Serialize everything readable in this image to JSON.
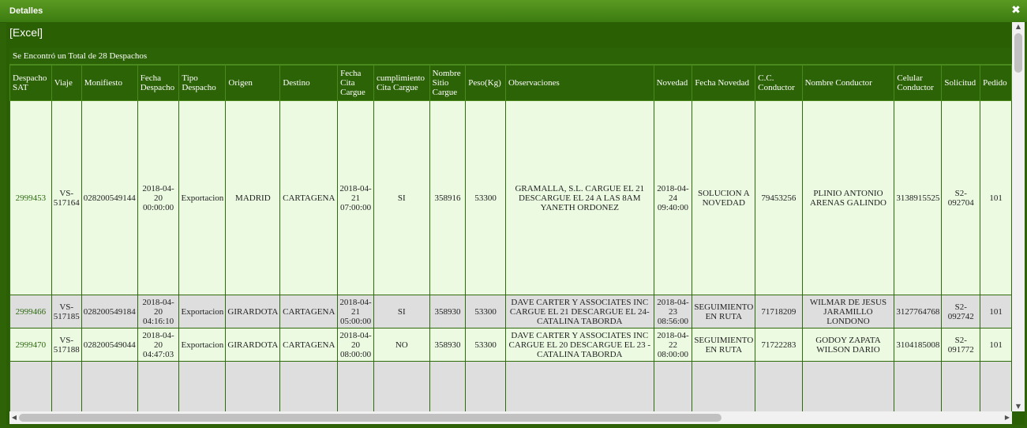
{
  "dialog": {
    "title": "Detalles",
    "close_icon": "close-icon",
    "excel_link": "[Excel]"
  },
  "summary": "Se Encontró un Total de 28 Despachos",
  "columns": [
    "Despacho SAT",
    "Viaje",
    "Monifiesto",
    "Fecha Despacho",
    "Tipo Despacho",
    "Origen",
    "Destino",
    "Fecha Cita Cargue",
    "cumplimiento Cita Cargue",
    "Nombre Sitio Cargue",
    "Peso(Kg)",
    "Observaciones",
    "Novedad",
    "Fecha Novedad",
    "C.C. Conductor",
    "Nombre Conductor",
    "Celular Conductor",
    "Solicitud",
    "Pedido"
  ],
  "rows": [
    [
      "2999453",
      "VS-517164",
      "028200549144",
      "2018-04-20 00:00:00",
      "Exportacion",
      "MADRID",
      "CARTAGENA",
      "2018-04-21 07:00:00",
      "SI",
      "358916",
      "53300",
      "GRAMALLA, S.L. CARGUE EL 21 DESCARGUE EL 24 A LAS 8AM YANETH ORDONEZ",
      "2018-04-24 09:40:00",
      "SOLUCION A NOVEDAD",
      "79453256",
      "PLINIO ANTONIO ARENAS GALINDO",
      "3138915525",
      "S2-092704",
      "101"
    ],
    [
      "2999466",
      "VS-517185",
      "028200549184",
      "2018-04-20 04:16:10",
      "Exportacion",
      "GIRARDOTA",
      "CARTAGENA",
      "2018-04-21 05:00:00",
      "SI",
      "358930",
      "53300",
      "DAVE CARTER Y ASSOCIATES INC CARGUE EL 21 DESCARGUE EL 24- CATALINA TABORDA",
      "2018-04-23 08:56:00",
      "SEGUIMIENTO EN RUTA",
      "71718209",
      "WILMAR DE JESUS JARAMILLO LONDONO",
      "3127764768",
      "S2-092742",
      "101"
    ],
    [
      "2999470",
      "VS-517188",
      "028200549044",
      "2018-04-20 04:47:03",
      "Exportacion",
      "GIRARDOTA",
      "CARTAGENA",
      "2018-04-20 08:00:00",
      "NO",
      "358930",
      "53300",
      "DAVE CARTER Y ASSOCIATES INC CARGUE EL 20 DESCARGUE EL 23 - CATALINA TABORDA",
      "2018-04-22 08:00:00",
      "SEGUIMIENTO EN RUTA",
      "71722283",
      "GODOY ZAPATA WILSON DARIO",
      "3104185008",
      "S2-091772",
      "101"
    ],
    [
      "",
      "",
      "",
      "",
      "",
      "",
      "",
      "",
      "",
      "",
      "",
      "",
      "",
      "",
      "",
      "",
      "",
      "",
      ""
    ]
  ]
}
